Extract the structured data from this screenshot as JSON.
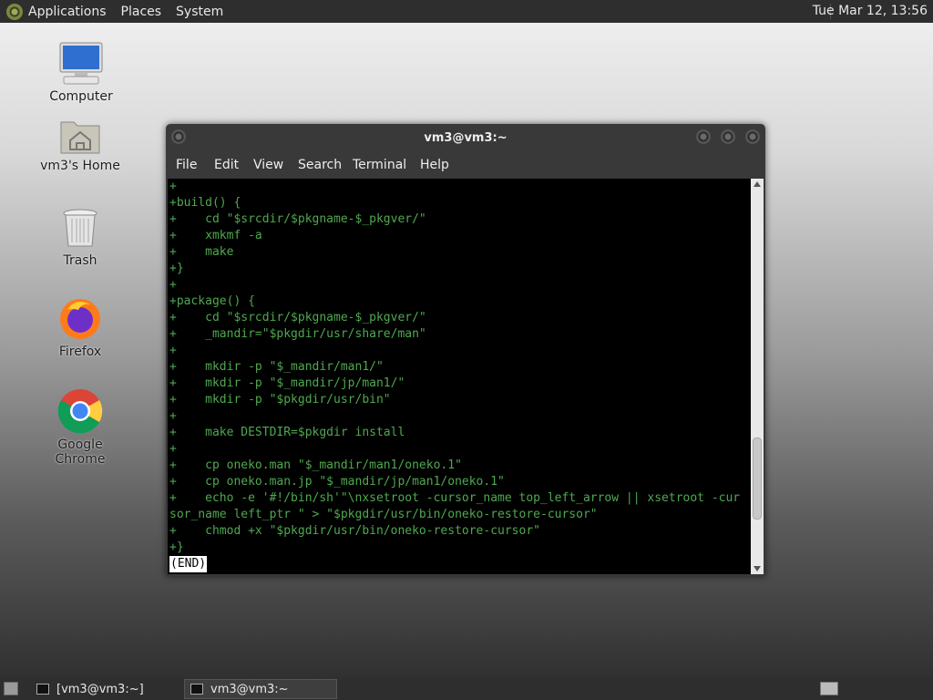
{
  "top_panel": {
    "menus": [
      "Applications",
      "Places",
      "System"
    ],
    "clock": "Tue Mar 12, 13:56"
  },
  "desktop": {
    "icons": [
      {
        "label": "Computer",
        "icon": "computer-icon"
      },
      {
        "label": "vm3's Home",
        "icon": "home-folder-icon"
      },
      {
        "label": "Trash",
        "icon": "trash-icon"
      },
      {
        "label": "Firefox",
        "icon": "firefox-icon"
      },
      {
        "label": "Google Chrome",
        "icon": "chrome-icon"
      }
    ]
  },
  "terminal": {
    "title": "vm3@vm3:~",
    "menu": [
      "File",
      "Edit",
      "View",
      "Search",
      "Terminal",
      "Help"
    ],
    "lines": [
      "+",
      "+build() {",
      "+    cd \"$srcdir/$pkgname-$_pkgver/\"",
      "+    xmkmf -a",
      "+    make",
      "+}",
      "+",
      "+package() {",
      "+    cd \"$srcdir/$pkgname-$_pkgver/\"",
      "+    _mandir=\"$pkgdir/usr/share/man\"",
      "+",
      "+    mkdir -p \"$_mandir/man1/\"",
      "+    mkdir -p \"$_mandir/jp/man1/\"",
      "+    mkdir -p \"$pkgdir/usr/bin\"",
      "+",
      "+    make DESTDIR=$pkgdir install",
      "+",
      "+    cp oneko.man \"$_mandir/man1/oneko.1\"",
      "+    cp oneko.man.jp \"$_mandir/jp/man1/oneko.1\"",
      "+    echo -e '#!/bin/sh'\"\\nxsetroot -cursor_name top_left_arrow || xsetroot -cur",
      "sor_name left_ptr \" > \"$pkgdir/usr/bin/oneko-restore-cursor\"",
      "+    chmod +x \"$pkgdir/usr/bin/oneko-restore-cursor\"",
      "+}"
    ],
    "status": "(END)",
    "scroll_position_fraction": 0.85
  },
  "taskbar": {
    "tasks": [
      {
        "label": "[vm3@vm3:~]",
        "active": false
      },
      {
        "label": "vm3@vm3:~",
        "active": true
      }
    ]
  }
}
